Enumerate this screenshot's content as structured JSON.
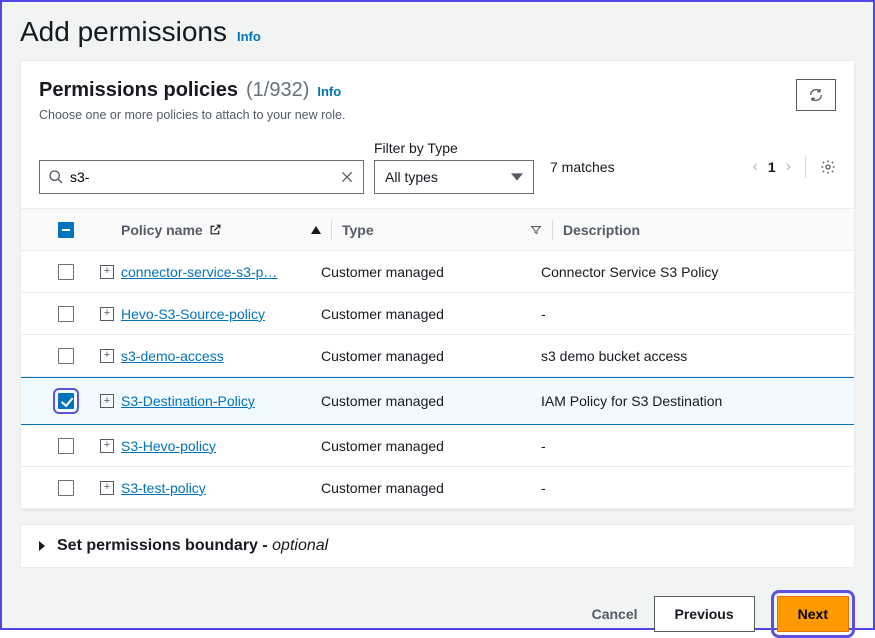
{
  "header": {
    "title": "Add permissions",
    "info": "Info"
  },
  "panel": {
    "title": "Permissions policies",
    "count": "(1/932)",
    "info": "Info",
    "subtitle": "Choose one or more policies to attach to your new role."
  },
  "filter": {
    "type_label": "Filter by Type",
    "search_value": "s3-",
    "type_value": "All types",
    "matches": "7 matches",
    "page": "1"
  },
  "columns": {
    "name": "Policy name",
    "type": "Type",
    "desc": "Description"
  },
  "rows": [
    {
      "checked": false,
      "name": "connector-service-s3-p…",
      "type": "Customer managed",
      "desc": "Connector Service S3 Policy"
    },
    {
      "checked": false,
      "name": "Hevo-S3-Source-policy",
      "type": "Customer managed",
      "desc": "-"
    },
    {
      "checked": false,
      "name": "s3-demo-access",
      "type": "Customer managed",
      "desc": "s3 demo bucket access"
    },
    {
      "checked": true,
      "name": "S3-Destination-Policy",
      "type": "Customer managed",
      "desc": "IAM Policy for S3 Destination"
    },
    {
      "checked": false,
      "name": "S3-Hevo-policy",
      "type": "Customer managed",
      "desc": "-"
    },
    {
      "checked": false,
      "name": "S3-test-policy",
      "type": "Customer managed",
      "desc": "-"
    }
  ],
  "boundary": {
    "label_bold": "Set permissions boundary - ",
    "label_opt": "optional"
  },
  "buttons": {
    "cancel": "Cancel",
    "previous": "Previous",
    "next": "Next"
  }
}
